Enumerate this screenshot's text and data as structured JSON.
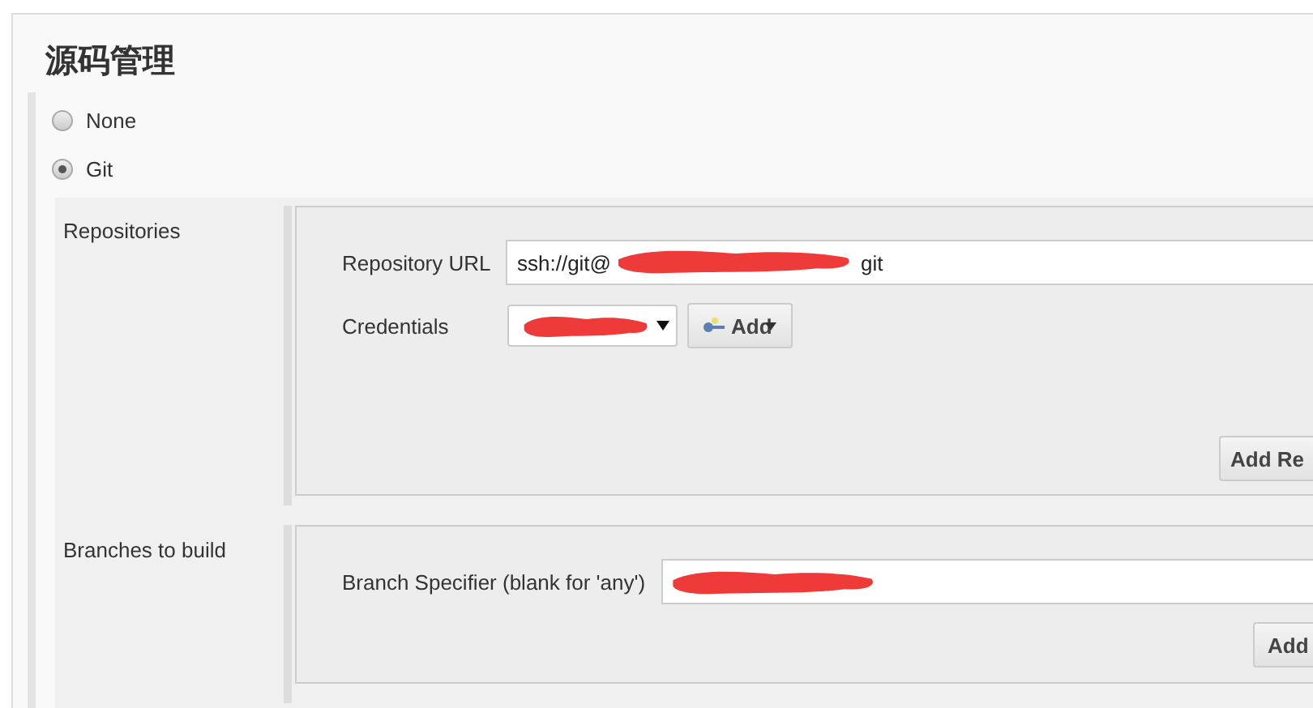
{
  "section_title": "源码管理",
  "scm_options": [
    {
      "label": "None",
      "selected": false
    },
    {
      "label": "Git",
      "selected": true
    }
  ],
  "repositories": {
    "label": "Repositories",
    "url_label": "Repository URL",
    "url_value_start": "ssh://git@",
    "url_value_end": "git",
    "url_redacted": true,
    "credentials_label": "Credentials",
    "credentials_redacted": true,
    "add_button": "Add",
    "add_repository_button": "Add Re"
  },
  "branches": {
    "label": "Branches to build",
    "specifier_label": "Branch Specifier (blank for 'any')",
    "specifier_redacted": true,
    "add_button": "Add"
  }
}
